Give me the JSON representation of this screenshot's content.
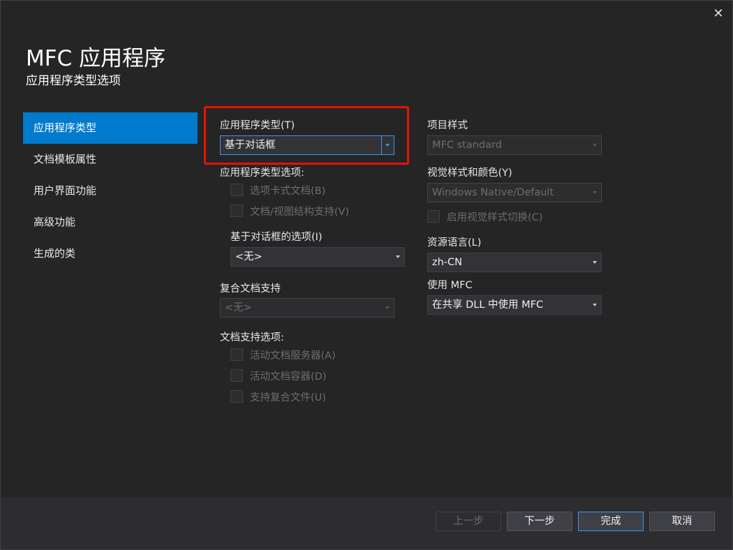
{
  "header": {
    "title": "MFC 应用程序",
    "subtitle": "应用程序类型选项"
  },
  "icons": {
    "close": "✕"
  },
  "nav": {
    "items": [
      {
        "label": "应用程序类型",
        "active": true
      },
      {
        "label": "文档模板属性",
        "active": false
      },
      {
        "label": "用户界面功能",
        "active": false
      },
      {
        "label": "高级功能",
        "active": false
      },
      {
        "label": "生成的类",
        "active": false
      }
    ]
  },
  "left": {
    "app_type_label": "应用程序类型(T)",
    "app_type_value": "基于对话框",
    "app_type_options_label": "应用程序类型选项:",
    "tabbed_docs": "选项卡式文档(B)",
    "doc_view_support": "文档/视图结构支持(V)",
    "dialog_options_label": "基于对话框的选项(I)",
    "dialog_options_value": "<无>",
    "compound_doc_label": "复合文档支持",
    "compound_doc_value": "<无>",
    "doc_support_label": "文档支持选项:",
    "active_doc_server": "活动文档服务器(A)",
    "active_doc_container": "活动文档容器(D)",
    "compound_files": "支持复合文件(U)"
  },
  "right": {
    "project_style_label": "项目样式",
    "project_style_value": "MFC standard",
    "visual_style_label": "视觉样式和颜色(Y)",
    "visual_style_value": "Windows Native/Default",
    "enable_visual_style_switch": "启用视觉样式切换(C)",
    "resource_lang_label": "资源语言(L)",
    "resource_lang_value": "zh-CN",
    "use_mfc_label": "使用 MFC",
    "use_mfc_value": "在共享 DLL 中使用 MFC"
  },
  "footer": {
    "prev": "上一步",
    "next": "下一步",
    "finish": "完成",
    "cancel": "取消"
  },
  "colors": {
    "accent": "#007acc",
    "focus": "#3399ff",
    "highlight": "#e51400"
  }
}
